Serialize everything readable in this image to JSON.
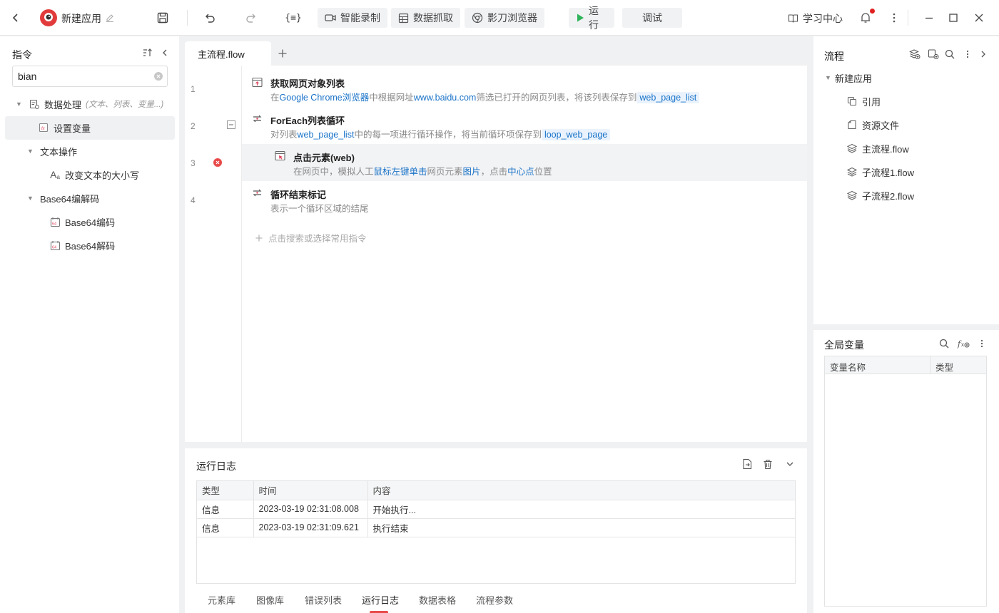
{
  "app": {
    "title": "新建应用"
  },
  "toolbar": {
    "smart_record": "智能录制",
    "data_capture": "数据抓取",
    "browser": "影刀浏览器",
    "run": "运行",
    "debug": "调试",
    "learning_center": "学习中心",
    "accent_color": "#1a73c8",
    "run_color": "#2fb35a",
    "notification_dot_color": "#e02020"
  },
  "commands": {
    "title": "指令",
    "search_value": "bian",
    "tree": [
      {
        "label": "数据处理",
        "hint": "(文本、列表、变量...)"
      },
      {
        "label": "设置变量"
      },
      {
        "label": "文本操作"
      },
      {
        "label": "改变文本的大小写"
      },
      {
        "label": "Base64编解码"
      },
      {
        "label": "Base64编码"
      },
      {
        "label": "Base64解码"
      }
    ]
  },
  "editor": {
    "tab_label": "主流程.flow",
    "line_numbers": [
      "1",
      "2",
      "3",
      "4"
    ],
    "steps": [
      {
        "title": "获取网页对象列表",
        "desc_parts": [
          "在",
          "Google Chrome浏览器",
          "中根据网址",
          "www.baidu.com",
          "筛选已打开的网页列表，将该列表保存到",
          "web_page_list"
        ]
      },
      {
        "title": "ForEach列表循环",
        "desc_parts": [
          "对列表",
          "web_page_list",
          "中的每一项进行循环操作，将当前循环项保存到",
          "loop_web_page"
        ]
      },
      {
        "title": "点击元素(web)",
        "desc_parts": [
          "在网页中，模拟人工",
          "鼠标左键单击",
          "网页元素",
          "图片",
          "，点击",
          "中心点",
          "位置"
        ]
      },
      {
        "title": "循环结束标记",
        "desc_parts": [
          "表示一个循环区域的结尾"
        ]
      }
    ],
    "add_hint": "点击搜索或选择常用指令"
  },
  "log": {
    "title": "运行日志",
    "columns": [
      "类型",
      "时间",
      "内容"
    ],
    "rows": [
      [
        "信息",
        "2023-03-19 02:31:08.008",
        "开始执行..."
      ],
      [
        "信息",
        "2023-03-19 02:31:09.621",
        "执行结束"
      ]
    ],
    "bottom_tabs": [
      "元素库",
      "图像库",
      "错误列表",
      "运行日志",
      "数据表格",
      "流程参数"
    ],
    "active_tab": "运行日志"
  },
  "flow_panel": {
    "title": "流程",
    "root": "新建应用",
    "items": [
      "引用",
      "资源文件",
      "主流程.flow",
      "子流程1.flow",
      "子流程2.flow"
    ]
  },
  "globals": {
    "title": "全局变量",
    "columns": [
      "变量名称",
      "类型"
    ]
  }
}
